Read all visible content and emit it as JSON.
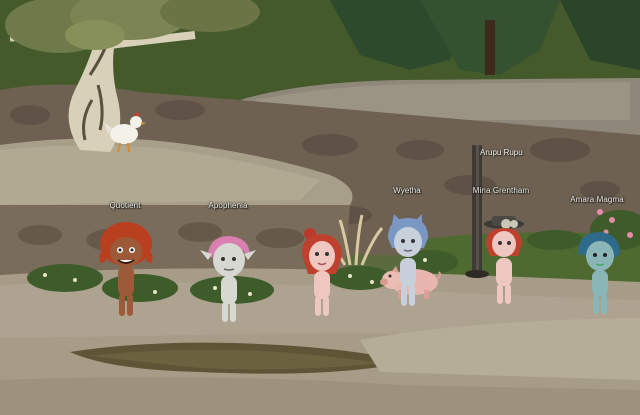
{
  "players": [
    {
      "name": "Quotient"
    },
    {
      "name": "Apophenia"
    },
    {
      "name": "Wyetha"
    },
    {
      "name": "Mina Grentham"
    },
    {
      "name": "Amara Magma"
    }
  ],
  "signpost": {
    "label": "Arupu Rupu"
  },
  "colors": {
    "grass": "#4e6233",
    "rock_path": "#a69c87",
    "cliff": "#6b5e4f",
    "sky_forest": "#2f4a2e"
  },
  "icons": [
    "tree",
    "chicken",
    "pig",
    "signpost",
    "bush",
    "flower"
  ]
}
